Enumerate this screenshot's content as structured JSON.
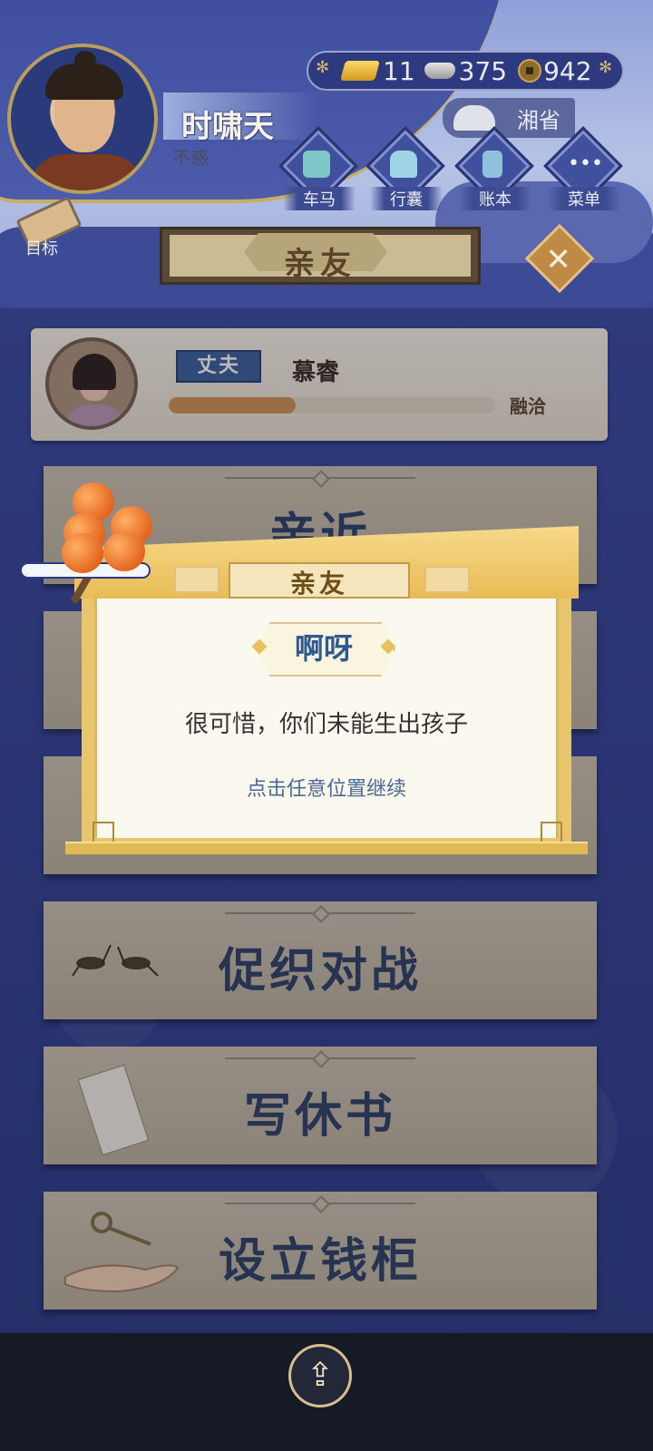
{
  "player": {
    "name": "时啸天",
    "title": "不惑"
  },
  "currency": {
    "gold": "11",
    "silver": "375",
    "coins": "942"
  },
  "location": {
    "province": "湘省"
  },
  "nav": [
    {
      "label": "车马",
      "icon": "carriage-icon"
    },
    {
      "label": "行囊",
      "icon": "bag-icon"
    },
    {
      "label": "账本",
      "icon": "ledger-icon"
    },
    {
      "label": "菜单",
      "icon": "menu-icon"
    }
  ],
  "goal": {
    "label": "目标"
  },
  "page": {
    "title": "亲友"
  },
  "spouse": {
    "role": "丈夫",
    "name": "慕睿",
    "relation": "融洽",
    "affinity": 0.39
  },
  "actions": [
    {
      "label": "亲近"
    },
    {
      "label": ""
    },
    {
      "label": ""
    },
    {
      "label": "促织对战",
      "icon": "cricket-icon"
    },
    {
      "label": "写休书",
      "icon": "letter-icon"
    },
    {
      "label": "设立钱柜",
      "icon": "key-icon"
    }
  ],
  "modal": {
    "header": "亲友",
    "exclamation": "啊呀",
    "message": "很可惜，你们未能生出孩子",
    "hint": "点击任意位置继续"
  },
  "colors": {
    "accent": "#e9bb55",
    "panel": "#c3b79e",
    "text_dark": "#2d3e5a"
  }
}
